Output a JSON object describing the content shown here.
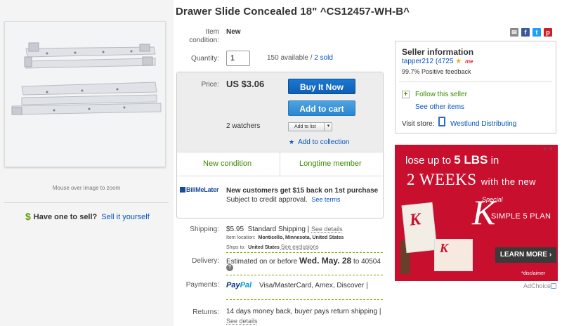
{
  "title": "Drawer Slide Concealed 18\" ^CS12457-WH-B^",
  "left": {
    "zoom_hint": "Mouse over image to zoom",
    "sell_question": "Have one to sell?",
    "sell_link": "Sell it yourself"
  },
  "details": {
    "condition_label": "Item\ncondition:",
    "condition_value": "New",
    "quantity_label": "Quantity:",
    "quantity_value": "1",
    "available": "150 available",
    "sold": "2 sold"
  },
  "purchase": {
    "price_label": "Price:",
    "price_value": "US $3.06",
    "buy_now": "Buy It Now",
    "add_to_cart": "Add to cart",
    "watchers": "2 watchers",
    "add_to_list": "Add to list",
    "add_to_collection": "Add to collection",
    "badge_new": "New condition",
    "badge_member": "Longtime member",
    "billmelater_logo": "BillMeLater",
    "billmelater_headline": "New customers get $15 back on 1st purchase",
    "billmelater_sub": "Subject to credit approval.",
    "see_terms": "See terms"
  },
  "shipping": {
    "label": "Shipping:",
    "cost": "$5.95",
    "method": "Standard Shipping",
    "see_details": "See details",
    "location_label": "Item location:",
    "location_value": "Monticello, Minnesota, United States",
    "ships_to_label": "Ships to:",
    "ships_to_value": "United States",
    "see_exclusions": "See exclusions"
  },
  "delivery": {
    "label": "Delivery:",
    "prefix": "Estimated on or before",
    "date": "Wed. May. 28",
    "suffix": "to 40504"
  },
  "payments": {
    "label": "Payments:",
    "paypal_pay": "Pay",
    "paypal_pal": "Pal",
    "methods": "Visa/MasterCard, Amex, Discover"
  },
  "returns": {
    "label": "Returns:",
    "text": "14 days money back, buyer pays return shipping",
    "see_details": "See details"
  },
  "seller": {
    "title": "Seller information",
    "name": "tapper212",
    "score": "(4725",
    "feedback": "99.7% Positive feedback",
    "follow": "Follow this seller",
    "other_items": "See other items",
    "visit_store_label": "Visit store:",
    "store_name": "Westlund Distributing"
  },
  "ad": {
    "line1_pre": "lose up to",
    "line1_num": "5 LBS",
    "line1_post": "in",
    "line2": "2 WEEKS",
    "line2_post": "with the new",
    "special": "Special",
    "k": "K",
    "plan": "SIMPLE 5 PLAN",
    "cta": "LEARN MORE",
    "disclaimer": "*disclaimer",
    "adchoice": "AdChoice"
  },
  "colors": {
    "link": "#0654ba",
    "green": "#3a8a00",
    "buy_button": "#0e5fb5",
    "cart_button": "#2a86cf",
    "ad_red": "#c8102e"
  }
}
